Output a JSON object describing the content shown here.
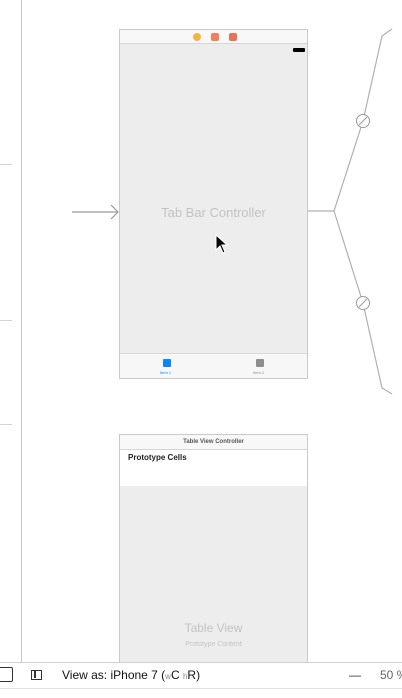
{
  "tab_bar_scene": {
    "title": "Tab Bar Controller",
    "dock_colors": [
      "#f2b544",
      "#f08060",
      "#e8735a"
    ],
    "tabs": [
      {
        "label": "Item 1",
        "color": "#0a84ff"
      },
      {
        "label": "Item 2",
        "color": "#8e8e8e"
      }
    ]
  },
  "table_scene": {
    "header": "Table View Controller",
    "prototype_cells": "Prototype Cells",
    "title": "Table View",
    "subtitle": "Prototype Content"
  },
  "statusbar": {
    "view_as_prefix": "View as: iPhone 7 (",
    "size_w": "w",
    "size_c": "C",
    "size_h": "h",
    "size_r": "R)",
    "zoom_minus": "—",
    "zoom_value": "50 %"
  }
}
